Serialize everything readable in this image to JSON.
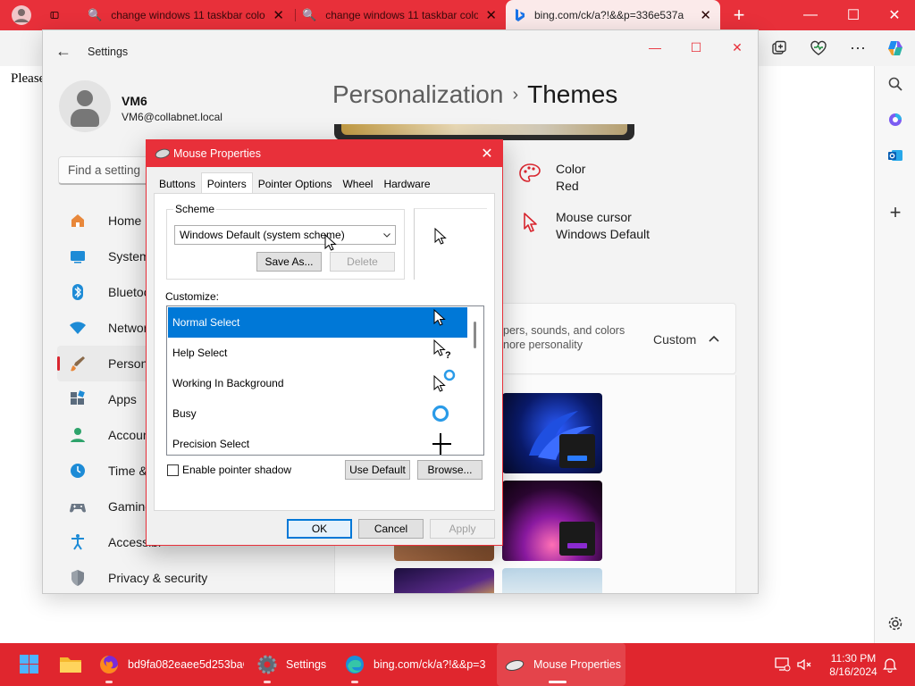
{
  "browser": {
    "tabs": [
      {
        "title": "change windows 11 taskbar colo",
        "active": false
      },
      {
        "title": "change windows 11 taskbar colo",
        "active": false
      },
      {
        "title": "bing.com/ck/a?!&&p=336e537a",
        "active": true
      }
    ],
    "new_tab_label": "+",
    "page_text": "Please",
    "accent_color": "#e8303a"
  },
  "settings": {
    "app_title": "Settings",
    "user": {
      "name": "VM6",
      "email": "VM6@collabnet.local"
    },
    "search_placeholder": "Find a setting",
    "nav": [
      {
        "label": "Home",
        "icon": "home-icon"
      },
      {
        "label": "System",
        "icon": "system-icon"
      },
      {
        "label": "Bluetooth",
        "icon": "bluetooth-icon"
      },
      {
        "label": "Network",
        "icon": "network-icon"
      },
      {
        "label": "Personali",
        "icon": "personalization-icon",
        "selected": true
      },
      {
        "label": "Apps",
        "icon": "apps-icon"
      },
      {
        "label": "Accounts",
        "icon": "accounts-icon"
      },
      {
        "label": "Time & la",
        "icon": "time-language-icon"
      },
      {
        "label": "Gaming",
        "icon": "gaming-icon"
      },
      {
        "label": "Accessibi",
        "icon": "accessibility-icon"
      },
      {
        "label": "Privacy & security",
        "icon": "privacy-shield-icon"
      }
    ],
    "breadcrumb": {
      "parent": "Personalization",
      "separator": "›",
      "current": "Themes"
    },
    "color": {
      "title": "Color",
      "value": "Red"
    },
    "mouse_cursor": {
      "title": "Mouse cursor",
      "value": "Windows Default"
    },
    "current_theme": {
      "description_line1": "pers, sounds, and colors",
      "description_line2": "nore personality",
      "value": "Custom"
    }
  },
  "mouse_properties": {
    "title": "Mouse Properties",
    "tabs": [
      "Buttons",
      "Pointers",
      "Pointer Options",
      "Wheel",
      "Hardware"
    ],
    "active_tab": "Pointers",
    "scheme_label": "Scheme",
    "scheme_value": "Windows Default (system scheme)",
    "save_as_label": "Save As...",
    "delete_label": "Delete",
    "customize_label": "Customize:",
    "pointers": [
      {
        "name": "Normal Select",
        "icon": "arrow-cursor-icon",
        "selected": true
      },
      {
        "name": "Help Select",
        "icon": "help-cursor-icon"
      },
      {
        "name": "Working In Background",
        "icon": "working-cursor-icon"
      },
      {
        "name": "Busy",
        "icon": "busy-cursor-icon"
      },
      {
        "name": "Precision Select",
        "icon": "crosshair-cursor-icon"
      }
    ],
    "shadow_label": "Enable pointer shadow",
    "shadow_checked": false,
    "use_default_label": "Use Default",
    "browse_label": "Browse...",
    "ok_label": "OK",
    "cancel_label": "Cancel",
    "apply_label": "Apply"
  },
  "taskbar": {
    "items": [
      {
        "label": "bd9fa082eaee5d253baC",
        "icon": "firefox-icon"
      },
      {
        "label": "Settings",
        "icon": "settings-gear-icon"
      },
      {
        "label": "bing.com/ck/a?!&&p=3",
        "icon": "edge-icon"
      },
      {
        "label": "Mouse Properties",
        "icon": "mouse-icon",
        "active": true
      }
    ],
    "time": "11:30 PM",
    "date": "8/16/2024",
    "bar_color": "#e0262e"
  }
}
